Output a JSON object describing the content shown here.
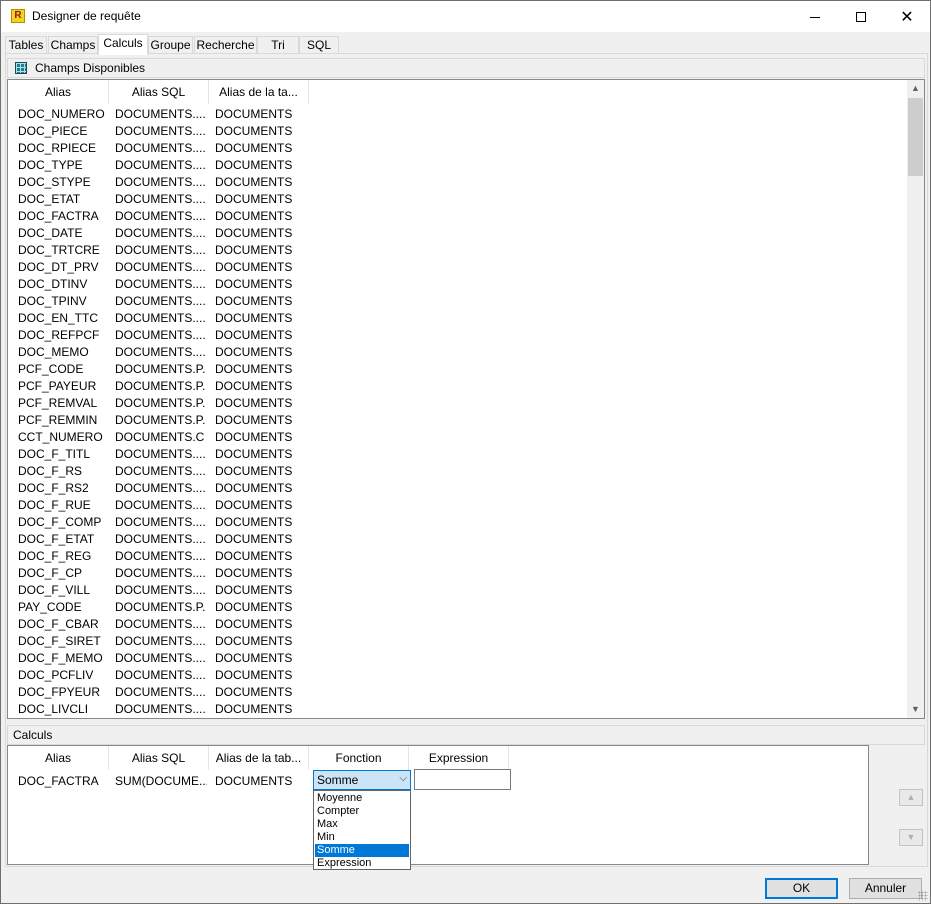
{
  "window": {
    "title": "Designer de requête",
    "app_icon_letter": "R",
    "controls": {
      "minimize": "minimize-icon",
      "maximize": "maximize-icon",
      "close": "close-icon"
    }
  },
  "tabs": [
    {
      "label": "Tables"
    },
    {
      "label": "Champs"
    },
    {
      "label": "Calculs",
      "active": true
    },
    {
      "label": "Groupe"
    },
    {
      "label": "Recherche"
    },
    {
      "label": "Tri"
    },
    {
      "label": "SQL"
    }
  ],
  "available": {
    "header": "Champs Disponibles",
    "columns": [
      "Alias",
      "Alias SQL",
      "Alias de la ta..."
    ],
    "rows": [
      [
        "DOC_NUMERO",
        "DOCUMENTS....",
        "DOCUMENTS"
      ],
      [
        "DOC_PIECE",
        "DOCUMENTS....",
        "DOCUMENTS"
      ],
      [
        "DOC_RPIECE",
        "DOCUMENTS....",
        "DOCUMENTS"
      ],
      [
        "DOC_TYPE",
        "DOCUMENTS....",
        "DOCUMENTS"
      ],
      [
        "DOC_STYPE",
        "DOCUMENTS....",
        "DOCUMENTS"
      ],
      [
        "DOC_ETAT",
        "DOCUMENTS....",
        "DOCUMENTS"
      ],
      [
        "DOC_FACTRA",
        "DOCUMENTS....",
        "DOCUMENTS"
      ],
      [
        "DOC_DATE",
        "DOCUMENTS....",
        "DOCUMENTS"
      ],
      [
        "DOC_TRTCRE",
        "DOCUMENTS....",
        "DOCUMENTS"
      ],
      [
        "DOC_DT_PRV",
        "DOCUMENTS....",
        "DOCUMENTS"
      ],
      [
        "DOC_DTINV",
        "DOCUMENTS....",
        "DOCUMENTS"
      ],
      [
        "DOC_TPINV",
        "DOCUMENTS....",
        "DOCUMENTS"
      ],
      [
        "DOC_EN_TTC",
        "DOCUMENTS....",
        "DOCUMENTS"
      ],
      [
        "DOC_REFPCF",
        "DOCUMENTS....",
        "DOCUMENTS"
      ],
      [
        "DOC_MEMO",
        "DOCUMENTS....",
        "DOCUMENTS"
      ],
      [
        "PCF_CODE",
        "DOCUMENTS.P...",
        "DOCUMENTS"
      ],
      [
        "PCF_PAYEUR",
        "DOCUMENTS.P...",
        "DOCUMENTS"
      ],
      [
        "PCF_REMVAL",
        "DOCUMENTS.P...",
        "DOCUMENTS"
      ],
      [
        "PCF_REMMIN",
        "DOCUMENTS.P...",
        "DOCUMENTS"
      ],
      [
        "CCT_NUMERO",
        "DOCUMENTS.C...",
        "DOCUMENTS"
      ],
      [
        "DOC_F_TITL",
        "DOCUMENTS....",
        "DOCUMENTS"
      ],
      [
        "DOC_F_RS",
        "DOCUMENTS....",
        "DOCUMENTS"
      ],
      [
        "DOC_F_RS2",
        "DOCUMENTS....",
        "DOCUMENTS"
      ],
      [
        "DOC_F_RUE",
        "DOCUMENTS....",
        "DOCUMENTS"
      ],
      [
        "DOC_F_COMP",
        "DOCUMENTS....",
        "DOCUMENTS"
      ],
      [
        "DOC_F_ETAT",
        "DOCUMENTS....",
        "DOCUMENTS"
      ],
      [
        "DOC_F_REG",
        "DOCUMENTS....",
        "DOCUMENTS"
      ],
      [
        "DOC_F_CP",
        "DOCUMENTS....",
        "DOCUMENTS"
      ],
      [
        "DOC_F_VILL",
        "DOCUMENTS....",
        "DOCUMENTS"
      ],
      [
        "PAY_CODE",
        "DOCUMENTS.P...",
        "DOCUMENTS"
      ],
      [
        "DOC_F_CBAR",
        "DOCUMENTS....",
        "DOCUMENTS"
      ],
      [
        "DOC_F_SIRET",
        "DOCUMENTS....",
        "DOCUMENTS"
      ],
      [
        "DOC_F_MEMO",
        "DOCUMENTS....",
        "DOCUMENTS"
      ],
      [
        "DOC_PCFLIV",
        "DOCUMENTS....",
        "DOCUMENTS"
      ],
      [
        "DOC_FPYEUR",
        "DOCUMENTS....",
        "DOCUMENTS"
      ],
      [
        "DOC_LIVCLI",
        "DOCUMENTS....",
        "DOCUMENTS"
      ]
    ]
  },
  "calculs": {
    "header": "Calculs",
    "columns": [
      "Alias",
      "Alias SQL",
      "Alias de la tab...",
      "Fonction",
      "Expression"
    ],
    "rows": [
      {
        "alias": "DOC_FACTRA",
        "alias_sql": "SUM(DOCUME...",
        "table_alias": "DOCUMENTS",
        "fonction": "Somme",
        "expression": ""
      }
    ],
    "fonction_options": [
      "Moyenne",
      "Compter",
      "Max",
      "Min",
      "Somme",
      "Expression"
    ],
    "selected_option": "Somme"
  },
  "buttons": {
    "ok": "OK",
    "cancel": "Annuler"
  },
  "colors": {
    "accent": "#0078d7",
    "selected_bg": "#cce4f7"
  }
}
